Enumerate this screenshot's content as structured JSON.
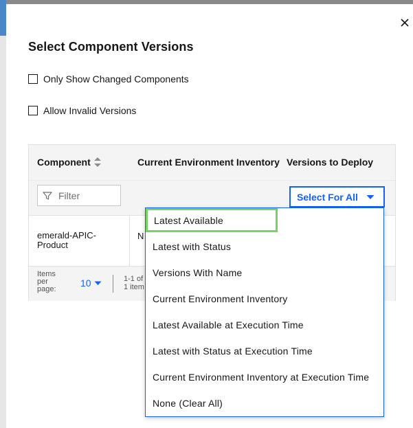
{
  "modal": {
    "title": "Select Component Versions",
    "close_icon": "close-icon"
  },
  "options": {
    "only_changed_label": "Only Show Changed Components",
    "only_changed_checked": false,
    "allow_invalid_label": "Allow Invalid Versions",
    "allow_invalid_checked": false
  },
  "table": {
    "headers": {
      "component": "Component",
      "current_env": "Current Environment Inventory",
      "versions": "Versions to Deploy"
    },
    "filter_placeholder": "Filter",
    "select_for_all_label": "Select For All",
    "rows": [
      {
        "component": "emerald-APIC-Product",
        "current_env": "N"
      }
    ],
    "pagination": {
      "items_per_page_label": "Items per page:",
      "page_size": "10",
      "range_line1": "1-1 of",
      "range_line2": "1 item"
    }
  },
  "dropdown": {
    "highlight_color": "#73d55f",
    "items": [
      "Latest Available",
      "Latest with Status",
      "Versions With Name",
      "Current Environment Inventory",
      "Latest Available at Execution Time",
      "Latest with Status at Execution Time",
      "Current Environment Inventory at Execution Time",
      "None (Clear All)"
    ]
  },
  "colors": {
    "accent": "#0f62fe",
    "text": "#161616",
    "header_bg": "#f4f4f4"
  }
}
